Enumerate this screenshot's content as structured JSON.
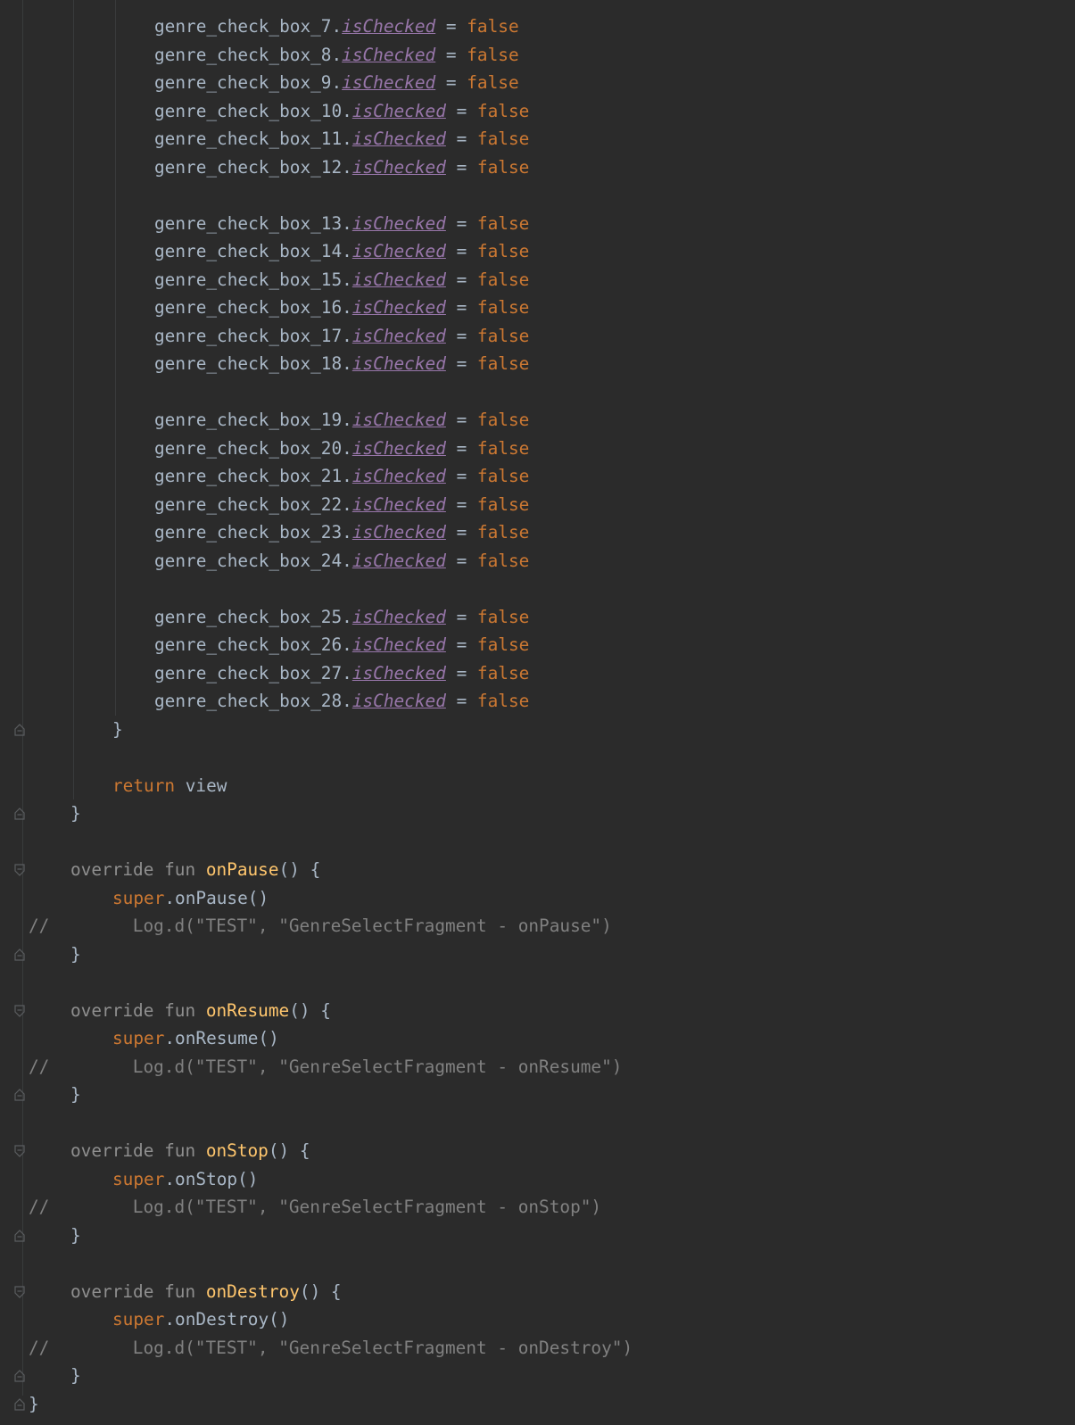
{
  "code": {
    "checkbox_lines": [
      {
        "receiver": "genre_check_box_7.",
        "property": "isChecked",
        "op": " = ",
        "value": "false"
      },
      {
        "receiver": "genre_check_box_8.",
        "property": "isChecked",
        "op": " = ",
        "value": "false"
      },
      {
        "receiver": "genre_check_box_9.",
        "property": "isChecked",
        "op": " = ",
        "value": "false"
      },
      {
        "receiver": "genre_check_box_10.",
        "property": "isChecked",
        "op": " = ",
        "value": "false"
      },
      {
        "receiver": "genre_check_box_11.",
        "property": "isChecked",
        "op": " = ",
        "value": "false"
      },
      {
        "receiver": "genre_check_box_12.",
        "property": "isChecked",
        "op": " = ",
        "value": "false"
      },
      {
        "receiver": "genre_check_box_13.",
        "property": "isChecked",
        "op": " = ",
        "value": "false"
      },
      {
        "receiver": "genre_check_box_14.",
        "property": "isChecked",
        "op": " = ",
        "value": "false"
      },
      {
        "receiver": "genre_check_box_15.",
        "property": "isChecked",
        "op": " = ",
        "value": "false"
      },
      {
        "receiver": "genre_check_box_16.",
        "property": "isChecked",
        "op": " = ",
        "value": "false"
      },
      {
        "receiver": "genre_check_box_17.",
        "property": "isChecked",
        "op": " = ",
        "value": "false"
      },
      {
        "receiver": "genre_check_box_18.",
        "property": "isChecked",
        "op": " = ",
        "value": "false"
      },
      {
        "receiver": "genre_check_box_19.",
        "property": "isChecked",
        "op": " = ",
        "value": "false"
      },
      {
        "receiver": "genre_check_box_20.",
        "property": "isChecked",
        "op": " = ",
        "value": "false"
      },
      {
        "receiver": "genre_check_box_21.",
        "property": "isChecked",
        "op": " = ",
        "value": "false"
      },
      {
        "receiver": "genre_check_box_22.",
        "property": "isChecked",
        "op": " = ",
        "value": "false"
      },
      {
        "receiver": "genre_check_box_23.",
        "property": "isChecked",
        "op": " = ",
        "value": "false"
      },
      {
        "receiver": "genre_check_box_24.",
        "property": "isChecked",
        "op": " = ",
        "value": "false"
      },
      {
        "receiver": "genre_check_box_25.",
        "property": "isChecked",
        "op": " = ",
        "value": "false"
      },
      {
        "receiver": "genre_check_box_26.",
        "property": "isChecked",
        "op": " = ",
        "value": "false"
      },
      {
        "receiver": "genre_check_box_27.",
        "property": "isChecked",
        "op": " = ",
        "value": "false"
      },
      {
        "receiver": "genre_check_box_28.",
        "property": "isChecked",
        "op": " = ",
        "value": "false"
      }
    ],
    "close_brace": "}",
    "return_keyword": "return",
    "return_value": " view",
    "overrides": [
      {
        "override_kw": "override",
        "fun_kw": "fun",
        "name": "onPause",
        "signature_tail": "() {",
        "super_kw": "super",
        "super_call": ".onPause()",
        "comment_prefix": "//",
        "comment_body": "Log.d(\"TEST\", \"GenreSelectFragment - onPause\")"
      },
      {
        "override_kw": "override",
        "fun_kw": "fun",
        "name": "onResume",
        "signature_tail": "() {",
        "super_kw": "super",
        "super_call": ".onResume()",
        "comment_prefix": "//",
        "comment_body": "Log.d(\"TEST\", \"GenreSelectFragment - onResume\")"
      },
      {
        "override_kw": "override",
        "fun_kw": "fun",
        "name": "onStop",
        "signature_tail": "() {",
        "super_kw": "super",
        "super_call": ".onStop()",
        "comment_prefix": "//",
        "comment_body": "Log.d(\"TEST\", \"GenreSelectFragment - onStop\")"
      },
      {
        "override_kw": "override",
        "fun_kw": "fun",
        "name": "onDestroy",
        "signature_tail": "() {",
        "super_kw": "super",
        "super_call": ".onDestroy()",
        "comment_prefix": "//",
        "comment_body": "Log.d(\"TEST\", \"GenreSelectFragment - onDestroy\")"
      }
    ],
    "class_close": "}"
  },
  "theme": {
    "background": "#2b2b2b",
    "identifier": "#a9b7c6",
    "keyword": "#cc7832",
    "function": "#ffc66d",
    "property": "#9876aa",
    "comment": "#808080"
  }
}
